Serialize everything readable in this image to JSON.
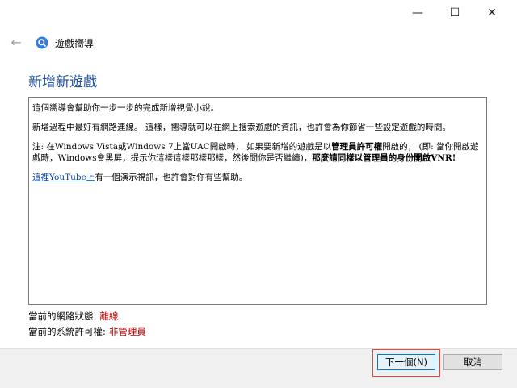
{
  "window": {
    "minimize": "—",
    "maximize": "☐",
    "close": "✕"
  },
  "nav": {
    "back": "←",
    "title": "遊戲嚮導"
  },
  "heading": "新增新遊戲",
  "content": {
    "p1": "這個嚮導會幫助你一步一步的完成新增視覺小說。",
    "p2": "新增過程中最好有網路連線。 這樣，嚮導就可以在網上搜索遊戲的資訊，也許會為你節省一些設定遊戲的時間。",
    "p3_a": "注: 在Windows Vista或Windows 7上當UAC開啟時， 如果要新增的遊戲是以",
    "p3_b": "管理員許可權",
    "p3_c": "開啟的， (即: 當你開啟遊戲時，Windows會黑屏，提示你這樣這樣那樣那樣，然後問你是否繼續)，",
    "p3_d": "那麼請同樣以管理員的身份開啟VNR!",
    "p4_link": "這裡YouTube上",
    "p4_rest": "有一個演示視訊，也許會對你有些幫助。"
  },
  "status": {
    "network_label": "當前的網路狀態:",
    "network_value": "離線",
    "perm_label": "當前的系統許可權:",
    "perm_value": "非管理員"
  },
  "buttons": {
    "next": "下一個(N)",
    "cancel": "取消"
  },
  "colors": {
    "heading": "#1e4e9c",
    "status_value": "#c00000",
    "link": "#0645ad",
    "highlight": "#e0483e"
  }
}
